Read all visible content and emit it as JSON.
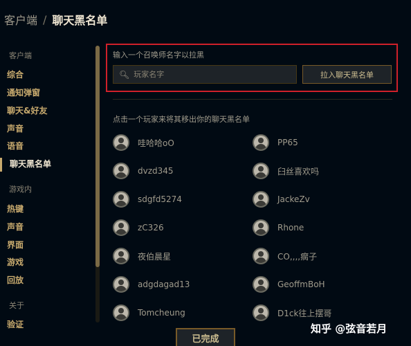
{
  "header": {
    "breadcrumb": "客户端",
    "separator": "/",
    "title": "聊天黑名单"
  },
  "sidebar": {
    "section_client": "客户端",
    "client_items": [
      "综合",
      "通知弹窗",
      "聊天&好友",
      "声音",
      "语音",
      "聊天黑名单"
    ],
    "section_ingame": "游戏内",
    "ingame_items": [
      "热键",
      "声音",
      "界面",
      "游戏",
      "回放"
    ],
    "section_about": "关于",
    "about_items": [
      "验证"
    ],
    "active": "聊天黑名单"
  },
  "blacklist": {
    "input_label": "输入一个召唤师名字以拉黑",
    "search_placeholder": "玩家名字",
    "add_button": "拉入聊天黑名单",
    "hint": "点击一个玩家来将其移出你的聊天黑名单",
    "players_left": [
      "哇哈哈oO",
      "dvzd345",
      "sdgfd5274",
      "zC326",
      "夜伯晨星",
      "adgdagad13",
      "Tomcheung"
    ],
    "players_right": [
      "PP65",
      "臼丝喜欢吗",
      "JackeZv",
      "Rhone",
      "CO,,,,瘸子",
      "GeoffmBoH",
      "D1ck往上摆哥"
    ]
  },
  "footer": {
    "done_button": "已完成"
  },
  "watermark": "知乎 @弦音若月",
  "colors": {
    "accent_gold": "#c8aa6e",
    "highlight_red": "#d0202a",
    "background": "#010a13"
  },
  "icons": {
    "search": "search-icon",
    "avatar": "user-avatar-icon"
  }
}
